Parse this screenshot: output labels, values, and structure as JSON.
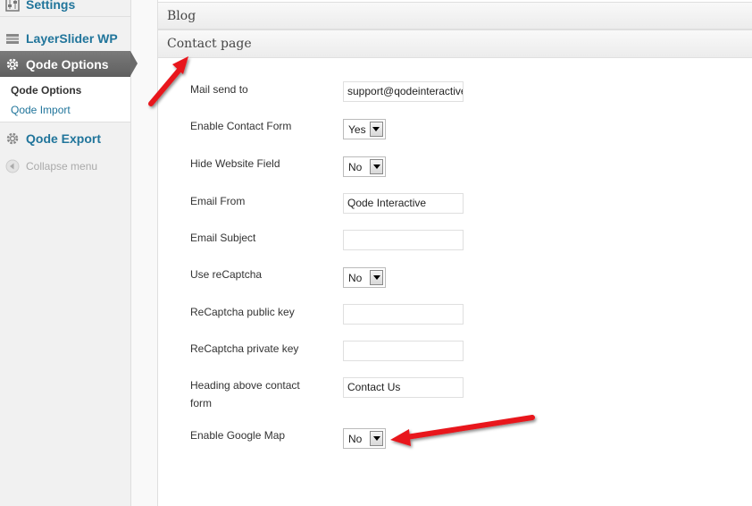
{
  "sidebar": {
    "settings_label": "Settings",
    "layerslider_label": "LayerSlider WP",
    "qode_options_label": "Qode Options",
    "submenu": {
      "qode_options": "Qode Options",
      "qode_import": "Qode Import"
    },
    "qode_export_label": "Qode Export",
    "collapse_label": "Collapse menu"
  },
  "main": {
    "sections": {
      "blog": "Blog",
      "contact_page": "Contact page"
    },
    "fields": {
      "mail_send_to": {
        "label": "Mail send to",
        "value": "support@qodeinteractive.com"
      },
      "enable_contact_form": {
        "label": "Enable Contact Form",
        "value": "Yes"
      },
      "hide_website_field": {
        "label": "Hide Website Field",
        "value": "No"
      },
      "email_from": {
        "label": "Email From",
        "value": "Qode Interactive"
      },
      "email_subject": {
        "label": "Email Subject",
        "value": ""
      },
      "use_recaptcha": {
        "label": "Use reCaptcha",
        "value": "No"
      },
      "recaptcha_public_key": {
        "label": "ReCaptcha public key",
        "value": ""
      },
      "recaptcha_private_key": {
        "label": "ReCaptcha private key",
        "value": ""
      },
      "heading_above_contact_form": {
        "label": "Heading above contact form",
        "value": "Contact Us"
      },
      "enable_google_map": {
        "label": "Enable Google Map",
        "value": "No"
      }
    }
  },
  "colors": {
    "link": "#21759b",
    "active_menu": "#6b6b6b",
    "annotation_arrow": "#e8151a"
  }
}
